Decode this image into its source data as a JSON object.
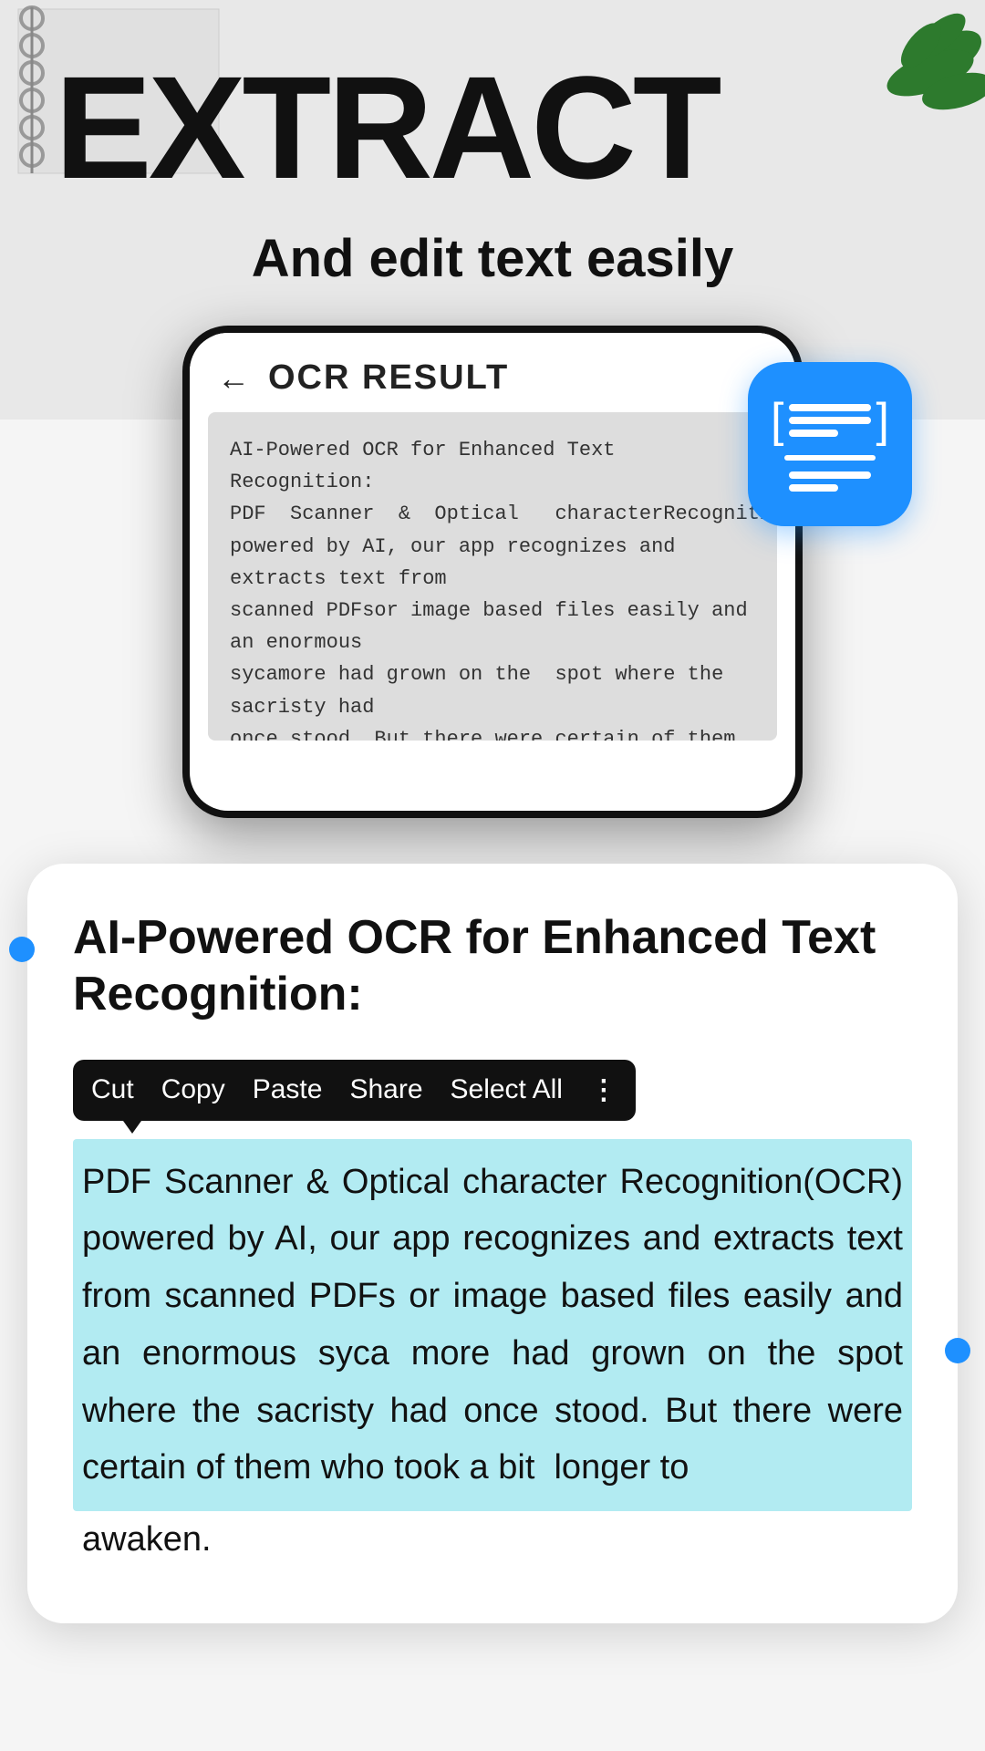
{
  "header": {
    "title": "EXTRACT",
    "subtitle": "And edit text easily"
  },
  "phone": {
    "screen_title": "OCR RESULT",
    "back_arrow": "←",
    "content_text": "AI-Powered OCR for Enhanced Text Recognition:\nPDF Scanner & Optical characterRecognition(OCR) powered by AI, our app recognizes and extracts text from scanned PDFsor image based files easily and an enormous sycamore had grown on the  spot where the sacristy had once stood. But there were certain of them who took a bit lon ger to awaken."
  },
  "context_menu": {
    "items": [
      "Cut",
      "Copy",
      "Paste",
      "Share",
      "Select All"
    ],
    "more_icon": "⋮"
  },
  "card": {
    "heading": "AI-Powered OCR for Enhanced Text Recognition:",
    "selected_text": "PDF Scanner & Optical character Recognition(OCR) powered by AI, our app recognizes and extracts text from scanned PDFs or image based files easily and an enormous syca more had grown on the spot where the sacristy had once stood. But there were certain of them who took a bit  longer to",
    "unselected_text": "awaken."
  },
  "app_icon": {
    "alt": "OCR Scanner App Icon"
  },
  "colors": {
    "accent": "#1e90ff",
    "selection": "#b2ebf2",
    "dark": "#111111",
    "white": "#ffffff"
  }
}
